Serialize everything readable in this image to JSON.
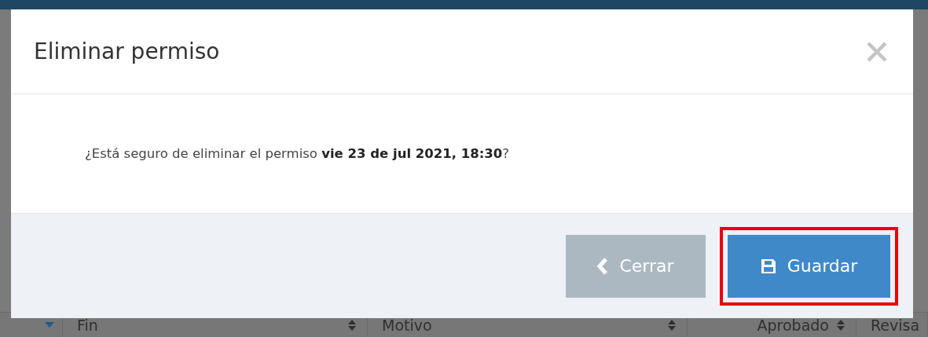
{
  "background_table": {
    "columns": [
      {
        "label": "Fin",
        "sortable": true
      },
      {
        "label": "Motivo",
        "sortable": true
      },
      {
        "label": "Aprobado",
        "sortable": true
      },
      {
        "label": "Revisa"
      }
    ]
  },
  "dialog": {
    "title": "Eliminar permiso",
    "message": "¿Está seguro de eliminar el permiso **vie 23 de jul 2021, 18:30**?",
    "buttons": [
      {
        "label": "Cerrar",
        "kind": "close",
        "highlighted": false
      },
      {
        "label": "Guardar",
        "kind": "save",
        "highlighted": true
      }
    ]
  }
}
